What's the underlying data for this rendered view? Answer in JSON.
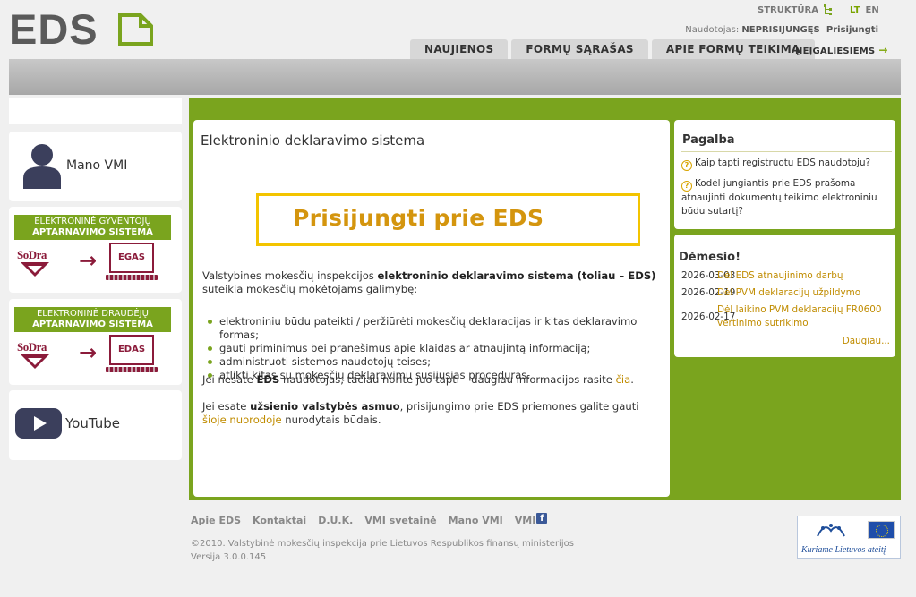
{
  "header": {
    "logo_text": "EDS",
    "structure_link": "STRUKTŪRA",
    "lang_lt": "LT",
    "lang_en": "EN",
    "user_label": "Naudotojas:",
    "user_value": "NEPRISIJUNGĘS",
    "login_link": "Prisijungti",
    "tabs": [
      "NAUJIENOS",
      "FORMŲ SĄRAŠAS",
      "APIE FORMŲ TEIKIMĄ"
    ],
    "accessibility_tab": "NEĮGALIESIEMS"
  },
  "left": {
    "vmi_label": "Mano VMI",
    "egas": {
      "line1": "ELEKTRONINĖ GYVENTOJŲ",
      "line2": "APTARNAVIMO SISTEMA",
      "brand": "SoDra",
      "system": "EGAS"
    },
    "edas": {
      "line1": "ELEKTRONINĖ DRAUDĖJŲ",
      "line2": "APTARNAVIMO SISTEMA",
      "brand": "SoDra",
      "system": "EDAS"
    },
    "youtube_label": "YouTube"
  },
  "main": {
    "title": "Elektroninio deklaravimo sistema",
    "login_button": "Prisijungti prie EDS",
    "intro_a": "Valstybinės mokesčių inspekcijos ",
    "intro_b": "elektroninio deklaravimo sistema (toliau – EDS)",
    "intro_c": " suteikia mokesčių mokėtojams galimybę:",
    "bullets": [
      "elektroniniu būdu pateikti / peržiūrėti mokesčių deklaracijas ir kitas deklaravimo formas;",
      "gauti priminimus bei pranešimus apie klaidas ar atnaujintą informaciją;",
      "administruoti sistemos naudotojų teises;",
      "atlikti kitas su mokesčių deklaravimu susijusias procedūras."
    ],
    "not_user_a": "Jei nesate ",
    "not_user_b": "EDS",
    "not_user_c": " naudotojas, tačiau norite juo tapti – daugiau informacijos rasite ",
    "not_user_link": "čia",
    "foreign_a": "Jei esate ",
    "foreign_b": "užsienio valstybės asmuo",
    "foreign_c": ", prisijungimo prie EDS priemones galite gauti ",
    "foreign_link": "šioje nuorodoje",
    "foreign_d": " nurodytais būdais."
  },
  "help": {
    "title": "Pagalba",
    "q1": "Kaip tapti registruotu EDS naudotoju?",
    "q2": "Kodėl jungiantis prie EDS prašoma atnaujinti dokumentų teikimo elektroniniu būdu sutartį?"
  },
  "notice": {
    "title": "Dėmesio!",
    "items": [
      {
        "date": "2026-03-03",
        "text": "Dėl EDS atnaujinimo darbų"
      },
      {
        "date": "2026-02-19",
        "text": "Dėl PVM deklaracijų užpildymo"
      },
      {
        "date": "2026-02-17",
        "text": "Dėl laikino PVM deklaracijų FR0600 vertinimo sutrikimo"
      }
    ],
    "more": "Daugiau..."
  },
  "footer": {
    "links": [
      "Apie EDS",
      "Kontaktai",
      "D.U.K.",
      "VMI svetainė",
      "Mano VMI",
      "VMI"
    ],
    "copyright": "©2010. Valstybinė mokesčių inspekcija prie Lietuvos Respublikos finansų ministerijos",
    "version": "Versija 3.0.0.145",
    "eu_slogan": "Kuriame Lietuvos ateitį"
  },
  "colors": {
    "green": "#7aa41e",
    "gold": "#d4950e",
    "yellow": "#f3c400",
    "sodra": "#8b1b3a"
  }
}
